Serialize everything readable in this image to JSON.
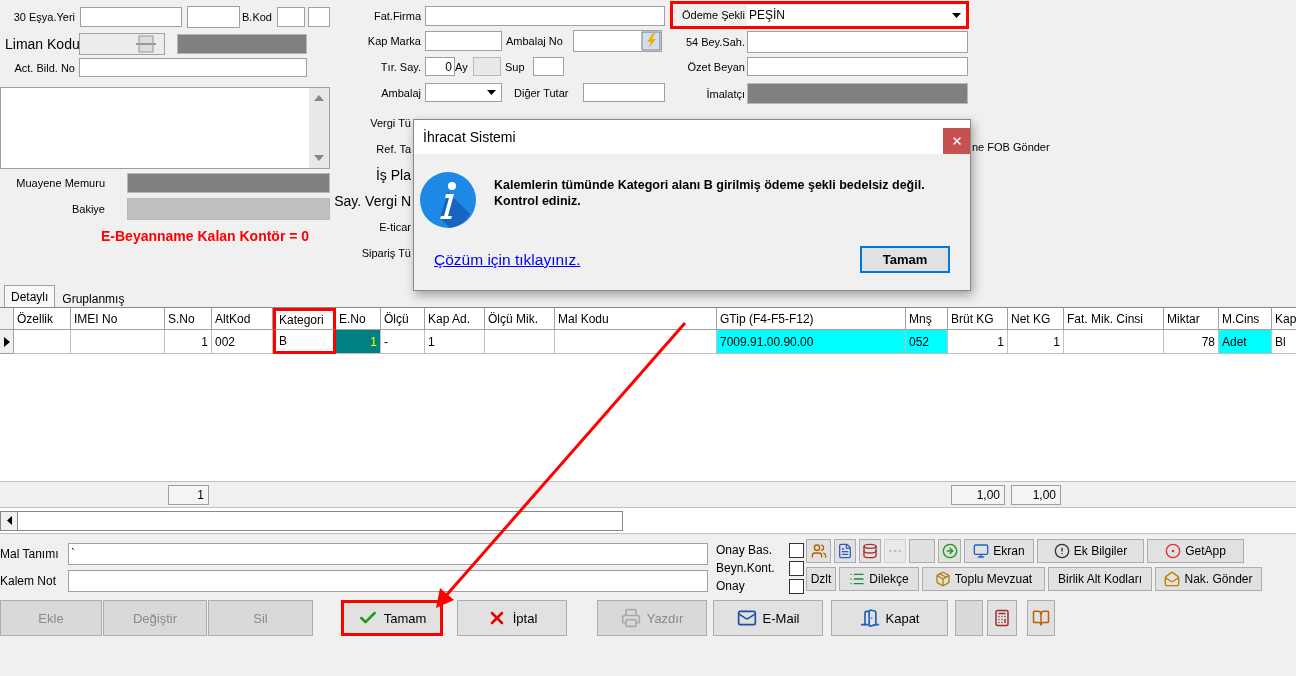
{
  "top_form": {
    "esya_yeri_label": "30 Eşya.Yeri",
    "b_kod_label": "B.Kod",
    "liman_kodu_label": "Liman Kodu",
    "act_bild_label": "Act. Bild. No",
    "muayene_label": "Muayene Memuru",
    "bakiye_label": "Bakiye",
    "kontor_text": "E-Beyanname Kalan Kontör = 0",
    "fat_firma_label": "Fat.Firma",
    "kap_marka_label": "Kap Marka",
    "ambalaj_no_label": "Ambalaj No",
    "tir_say": {
      "label": "Tır. Say.",
      "value": "0"
    },
    "ay_label": "Ay",
    "sup_label": "Sup",
    "ambalaj_label": "Ambalaj",
    "diger_tutar_label": "Diğer Tutar",
    "cut_labels": [
      {
        "text": "Vergi Tü",
        "kind": "small"
      },
      {
        "text": "Ref. Ta",
        "kind": "small"
      },
      {
        "text": "İş Pla",
        "kind": "large"
      },
      {
        "text": "Say. Vergi N",
        "kind": "large"
      },
      {
        "text": "E-ticar",
        "kind": "small"
      },
      {
        "text": "Sipariş Tü",
        "kind": "small"
      }
    ],
    "odeme_sekli": {
      "label": "Ödeme Şekli",
      "value": "PEŞİN",
      "highlighted": true
    },
    "bey_sah_label": "54 Bey.Sah.",
    "ozet_beyan_label": "Özet Beyan",
    "imalatci_label": "İmalatçı",
    "fob_text": "ne FOB Gönder"
  },
  "dialog": {
    "title": "İhracat Sistemi",
    "message": "Kalemlerin tümünde Kategori alanı B girilmiş ödeme şekli bedelsiz değil. Kontrol ediniz.",
    "link": "Çözüm için tıklayınız.",
    "ok_button": "Tamam"
  },
  "tabs": [
    {
      "label": "Detaylı",
      "selected": true
    },
    {
      "label": "Gruplanmış",
      "selected": false
    }
  ],
  "grid": {
    "columns": [
      {
        "label": "Özellik",
        "highlighted": false
      },
      {
        "label": "IMEI No",
        "highlighted": false
      },
      {
        "label": "S.No",
        "numeric": true,
        "total": "1",
        "highlighted": false
      },
      {
        "label": "AltKod",
        "highlighted": false
      },
      {
        "label": "Kategori",
        "highlighted": true
      },
      {
        "label": "E.No",
        "numeric": true,
        "highlighted": false
      },
      {
        "label": "Ölçü",
        "highlighted": false
      },
      {
        "label": "Kap Ad.",
        "highlighted": false
      },
      {
        "label": "Ölçü Mik.",
        "highlighted": false
      },
      {
        "label": "Mal Kodu",
        "highlighted": false
      },
      {
        "label": "GTip (F4-F5-F12)",
        "highlighted": false
      },
      {
        "label": "Mnş",
        "highlighted": false
      },
      {
        "label": "Brüt KG",
        "numeric": true,
        "total": "1,00",
        "highlighted": false
      },
      {
        "label": "Net KG",
        "numeric": true,
        "total": "1,00",
        "highlighted": false
      },
      {
        "label": "Fat. Mik. Cinsi",
        "highlighted": false
      },
      {
        "label": "Miktar",
        "numeric": true,
        "highlighted": false
      },
      {
        "label": "M.Cins",
        "highlighted": false
      },
      {
        "label": "Kap",
        "highlighted": false
      }
    ],
    "rows": [
      {
        "current": true,
        "cells": [
          {},
          {},
          {
            "text": "1"
          },
          {
            "text": "002"
          },
          {
            "text": "B"
          },
          {
            "text": "1",
            "focused": true
          },
          {
            "text": "-"
          },
          {
            "text": "1"
          },
          {},
          {},
          {
            "text": "7009.91.00.90.00",
            "color": "#00ffff"
          },
          {
            "text": "052",
            "color": "#00ffff"
          },
          {
            "text": "1"
          },
          {
            "text": "1"
          },
          {},
          {
            "text": "78"
          },
          {
            "text": "Adet",
            "color": "#00ffff"
          },
          {
            "text": "Bl"
          }
        ]
      }
    ]
  },
  "item_panel": {
    "mal_tanimi": {
      "label": "Mal Tanımı",
      "value": "`"
    },
    "kalem_not_label": "Kalem Not",
    "checkboxes": [
      {
        "label": "Onay Bas.",
        "checked": false
      },
      {
        "label": "Beyn.Kont.",
        "checked": false
      },
      {
        "label": "Onay",
        "checked": false
      }
    ]
  },
  "toolbar_rows": [
    [
      {
        "kind": "icon",
        "disabled": false
      },
      {
        "kind": "icon",
        "disabled": false
      },
      {
        "kind": "icon",
        "disabled": false
      },
      {
        "kind": "icon",
        "disabled": true
      },
      {
        "kind": "blank"
      },
      {
        "kind": "icon",
        "disabled": false
      },
      {
        "kind": "button",
        "label": "Ekran"
      },
      {
        "kind": "button",
        "label": "Ek Bilgiler"
      },
      {
        "kind": "button",
        "label": "GetApp"
      }
    ],
    [
      {
        "kind": "button",
        "label": "Dzlt"
      },
      {
        "kind": "button",
        "label": "Dilekçe"
      },
      {
        "kind": "button",
        "label": "Toplu Mevzuat"
      },
      {
        "kind": "button",
        "label": "Birlik Alt Kodları"
      },
      {
        "kind": "button",
        "label": "Nak. Gönder"
      }
    ]
  ],
  "action_buttons": [
    {
      "kind": "text",
      "label": "Ekle",
      "disabled": true,
      "highlighted": false
    },
    {
      "kind": "text",
      "label": "Değiştir",
      "disabled": true,
      "highlighted": false
    },
    {
      "kind": "text",
      "label": "Sil",
      "disabled": true,
      "highlighted": false
    },
    {
      "kind": "text",
      "label": "Tamam",
      "disabled": false,
      "highlighted": true
    },
    {
      "kind": "text",
      "label": "İptal",
      "disabled": false,
      "highlighted": false
    },
    {
      "kind": "text",
      "label": "Yazdır",
      "disabled": true,
      "highlighted": false
    },
    {
      "kind": "text",
      "label": "E-Mail",
      "disabled": false,
      "highlighted": false
    },
    {
      "kind": "text",
      "label": "Kapat",
      "disabled": false,
      "highlighted": false
    },
    {
      "kind": "blank"
    },
    {
      "kind": "icon"
    },
    {
      "kind": "icon"
    }
  ],
  "annotation_arrow": true
}
